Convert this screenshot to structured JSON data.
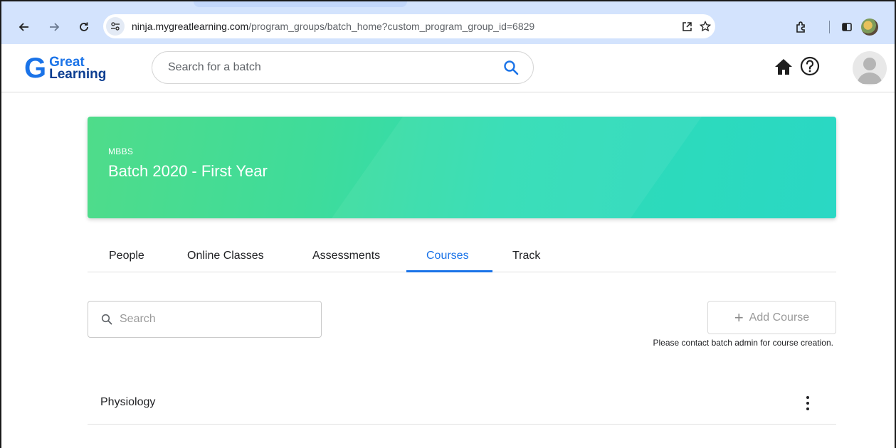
{
  "browser": {
    "url_host": "ninja.mygreatlearning.com",
    "url_path": "/program_groups/batch_home?custom_program_group_id=6829",
    "site_info_icon": "tune-icon"
  },
  "header": {
    "logo_line1": "Great",
    "logo_line2": "Learning",
    "logo_mark": "G",
    "search_placeholder": "Search for a batch"
  },
  "banner": {
    "program": "MBBS",
    "batch": "Batch 2020 - First Year",
    "colors": {
      "start": "#4fdc8a",
      "end": "#2ad8c4"
    }
  },
  "tabs": [
    {
      "label": "People",
      "active": false
    },
    {
      "label": "Online Classes",
      "active": false
    },
    {
      "label": "Assessments",
      "active": false
    },
    {
      "label": "Courses",
      "active": true
    },
    {
      "label": "Track",
      "active": false
    }
  ],
  "courses_panel": {
    "search_placeholder": "Search",
    "add_course_label": "Add Course",
    "contact_note": "Please contact batch admin for course creation.",
    "items": [
      {
        "name": "Physiology"
      }
    ]
  },
  "colors": {
    "accent": "#1a73e8"
  }
}
